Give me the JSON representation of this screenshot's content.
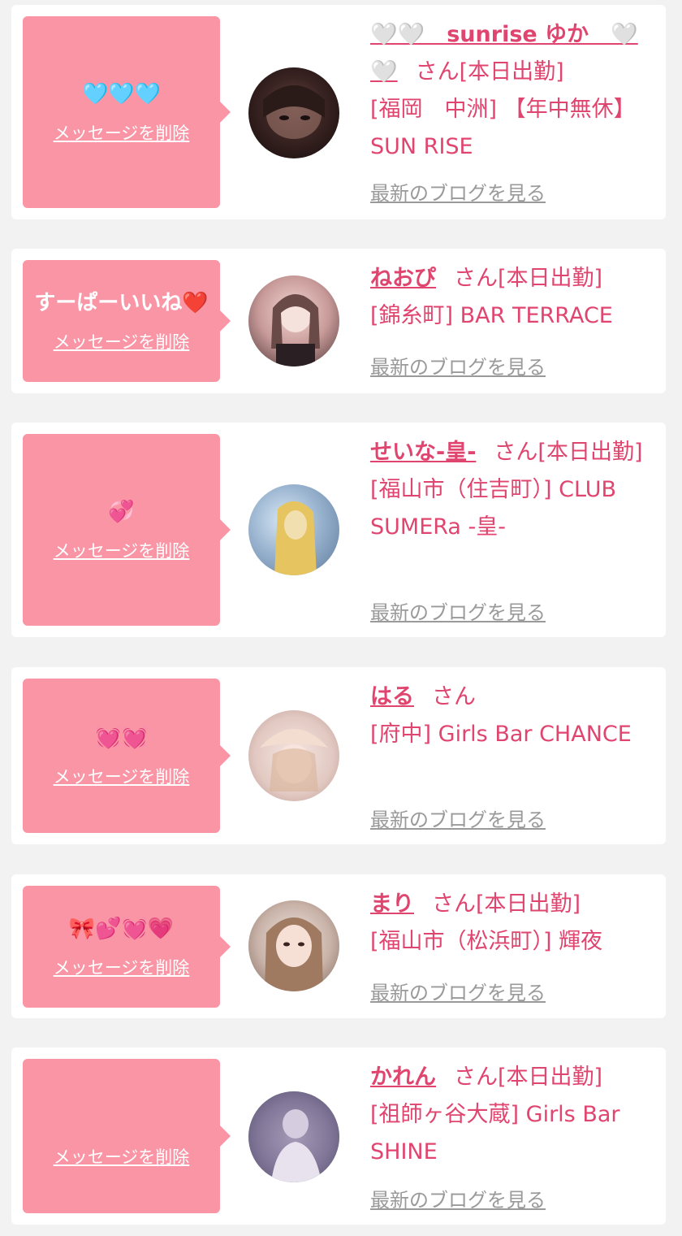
{
  "colors": {
    "page_bg": "#f2f2f2",
    "card_bg": "#ffffff",
    "bubble_bg": "#f995a5",
    "accent_text": "#e0456f",
    "muted_text": "#9a9a9a"
  },
  "labels": {
    "delete": "メッセージを削除",
    "blog": "最新のブログを見る"
  },
  "items": [
    {
      "message": "🩵🩵🩵",
      "name": "🤍🤍　sunrise ゆか　🤍🤍",
      "suffix": "さん[本日出勤]",
      "shop": "[福岡　中洲] 【年中無休】SUN RISE",
      "delete_label": "メッセージを削除",
      "blog_label": "最新のブログを見る",
      "avatar": "avatar-photo"
    },
    {
      "message": "すーぱーいいね❤️",
      "name": "ねおぴ",
      "suffix": "さん[本日出勤]",
      "shop": "[錦糸町] BAR TERRACE",
      "delete_label": "メッセージを削除",
      "blog_label": "最新のブログを見る",
      "avatar": "avatar-photo"
    },
    {
      "message": "💞",
      "name": "せいな-皇-",
      "suffix": "さん[本日出勤]",
      "shop": "[福山市（住吉町）] CLUB SUMERa -皇-",
      "delete_label": "メッセージを削除",
      "blog_label": "最新のブログを見る",
      "avatar": "avatar-photo"
    },
    {
      "message": "💓💓",
      "name": "はる",
      "suffix": "さん",
      "shop": "[府中] Girls Bar CHANCE",
      "delete_label": "メッセージを削除",
      "blog_label": "最新のブログを見る",
      "avatar": "avatar-photo"
    },
    {
      "message": "🎀💕💓💗",
      "name": "まり",
      "suffix": "さん[本日出勤]",
      "shop": "[福山市（松浜町）] 輝夜",
      "delete_label": "メッセージを削除",
      "blog_label": "最新のブログを見る",
      "avatar": "avatar-photo"
    },
    {
      "message": "",
      "name": "かれん",
      "suffix": "さん[本日出勤]",
      "shop": "[祖師ヶ谷大蔵] Girls Bar SHINE",
      "delete_label": "メッセージを削除",
      "blog_label": "最新のブログを見る",
      "avatar": "avatar-photo"
    }
  ]
}
